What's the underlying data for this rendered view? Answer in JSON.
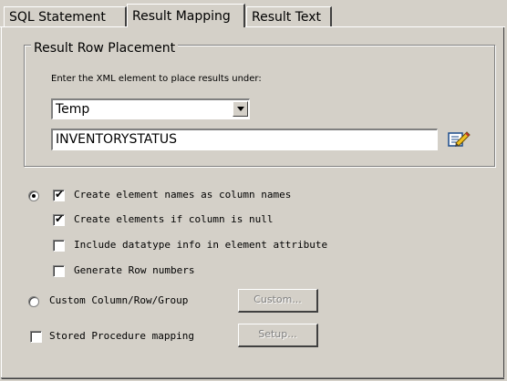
{
  "tabs": [
    "SQL Statement",
    "Result Mapping",
    "Result Text"
  ],
  "group": {
    "legend": "Result Row Placement",
    "instruction": "Enter the XML element to place results under:",
    "combo_value": "Temp",
    "element_value": "INVENTORYSTATUS"
  },
  "options": {
    "create_names": "Create element names as column names",
    "create_if_null": "Create elements if column is null",
    "include_datatype": "Include datatype info in element attribute",
    "generate_rows": "Generate Row numbers",
    "custom_group": "Custom Column/Row/Group",
    "custom_button": "Custom...",
    "stored_proc": "Stored Procedure mapping",
    "setup_button": "Setup..."
  },
  "state": {
    "radio_column_names": true,
    "create_names": true,
    "create_if_null": true,
    "include_datatype": false,
    "generate_rows": false,
    "radio_custom": false,
    "stored_proc": false
  }
}
